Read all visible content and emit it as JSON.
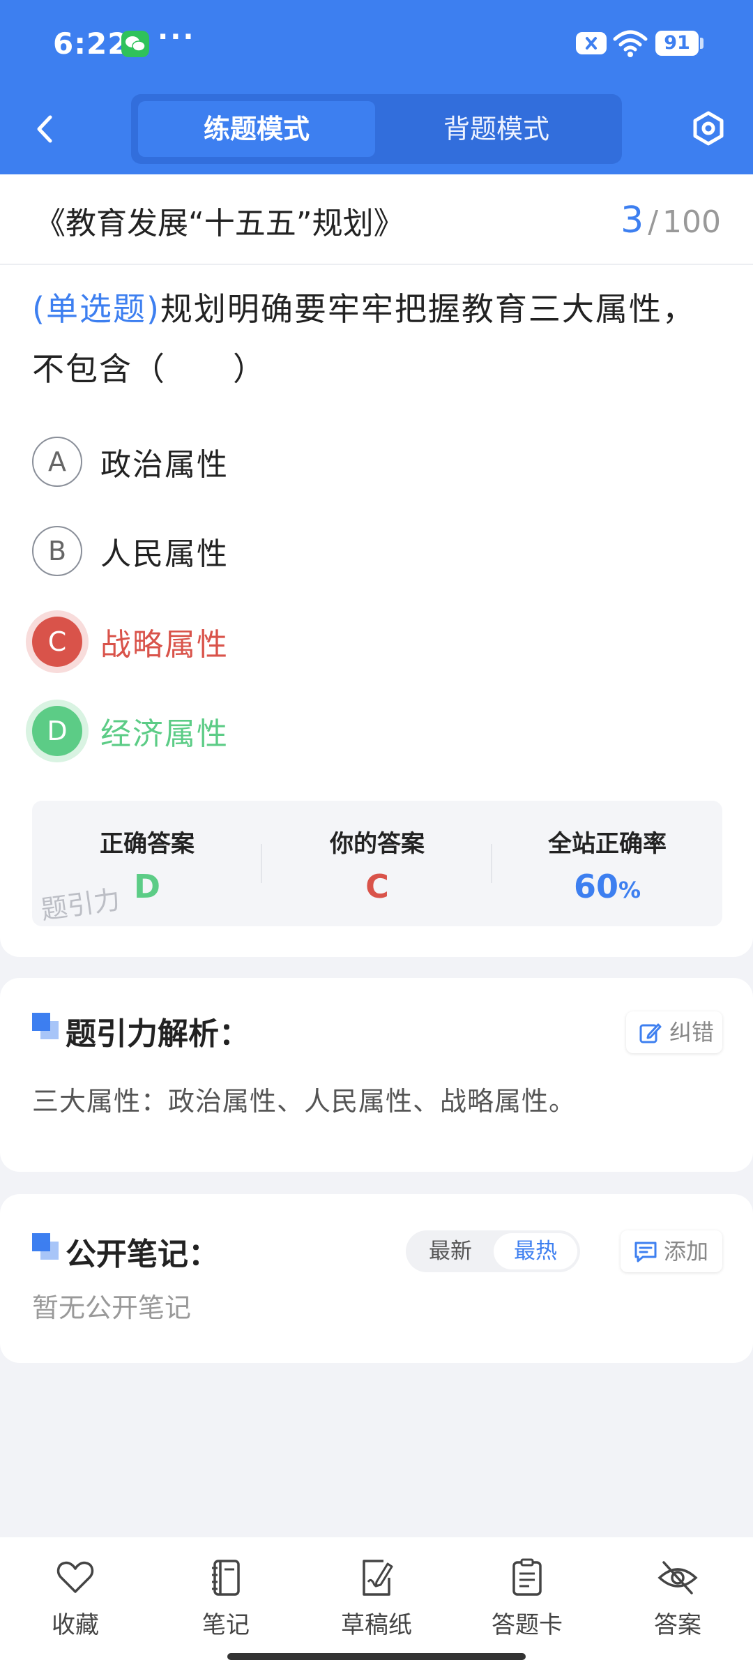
{
  "status_bar": {
    "time": "6:22",
    "dots": "···",
    "battery": "91"
  },
  "header": {
    "tabs": [
      {
        "label": "练题模式",
        "active": true
      },
      {
        "label": "背题模式",
        "active": false
      }
    ]
  },
  "question_card": {
    "doc_title": "《教育发展“十五五”规划》",
    "progress": {
      "current": "3",
      "separator": "/",
      "total": "100"
    },
    "question_type": "(单选题)",
    "question_line1": "规划明确要牢牢把握教育三大属性，",
    "question_line2": "不包含（　　）",
    "options": [
      {
        "letter": "A",
        "text": "政治属性",
        "state": "normal"
      },
      {
        "letter": "B",
        "text": "人民属性",
        "state": "normal"
      },
      {
        "letter": "C",
        "text": "战略属性",
        "state": "wrong"
      },
      {
        "letter": "D",
        "text": "经济属性",
        "state": "correct"
      }
    ],
    "answer_summary": {
      "correct_label": "正确答案",
      "correct_value": "D",
      "yours_label": "你的答案",
      "yours_value": "C",
      "rate_label": "全站正确率",
      "rate_value": "60",
      "rate_unit": "%"
    },
    "watermark": "题引力"
  },
  "analysis": {
    "title": "题引力解析：",
    "report_button": "纠错",
    "text": "三大属性：政治属性、人民属性、战略属性。"
  },
  "notes": {
    "title": "公开笔记：",
    "sort_latest": "最新",
    "sort_hot": "最热",
    "add_button": "添加",
    "empty": "暂无公开笔记"
  },
  "bottom_nav": [
    {
      "label": "收藏",
      "icon": "heart-icon"
    },
    {
      "label": "笔记",
      "icon": "notebook-icon"
    },
    {
      "label": "草稿纸",
      "icon": "draft-paper-icon"
    },
    {
      "label": "答题卡",
      "icon": "answer-sheet-icon"
    },
    {
      "label": "答案",
      "icon": "eye-off-icon"
    }
  ],
  "colors": {
    "primary": "#3d7ff0",
    "wrong": "#d9534a",
    "correct": "#5ccc86"
  }
}
